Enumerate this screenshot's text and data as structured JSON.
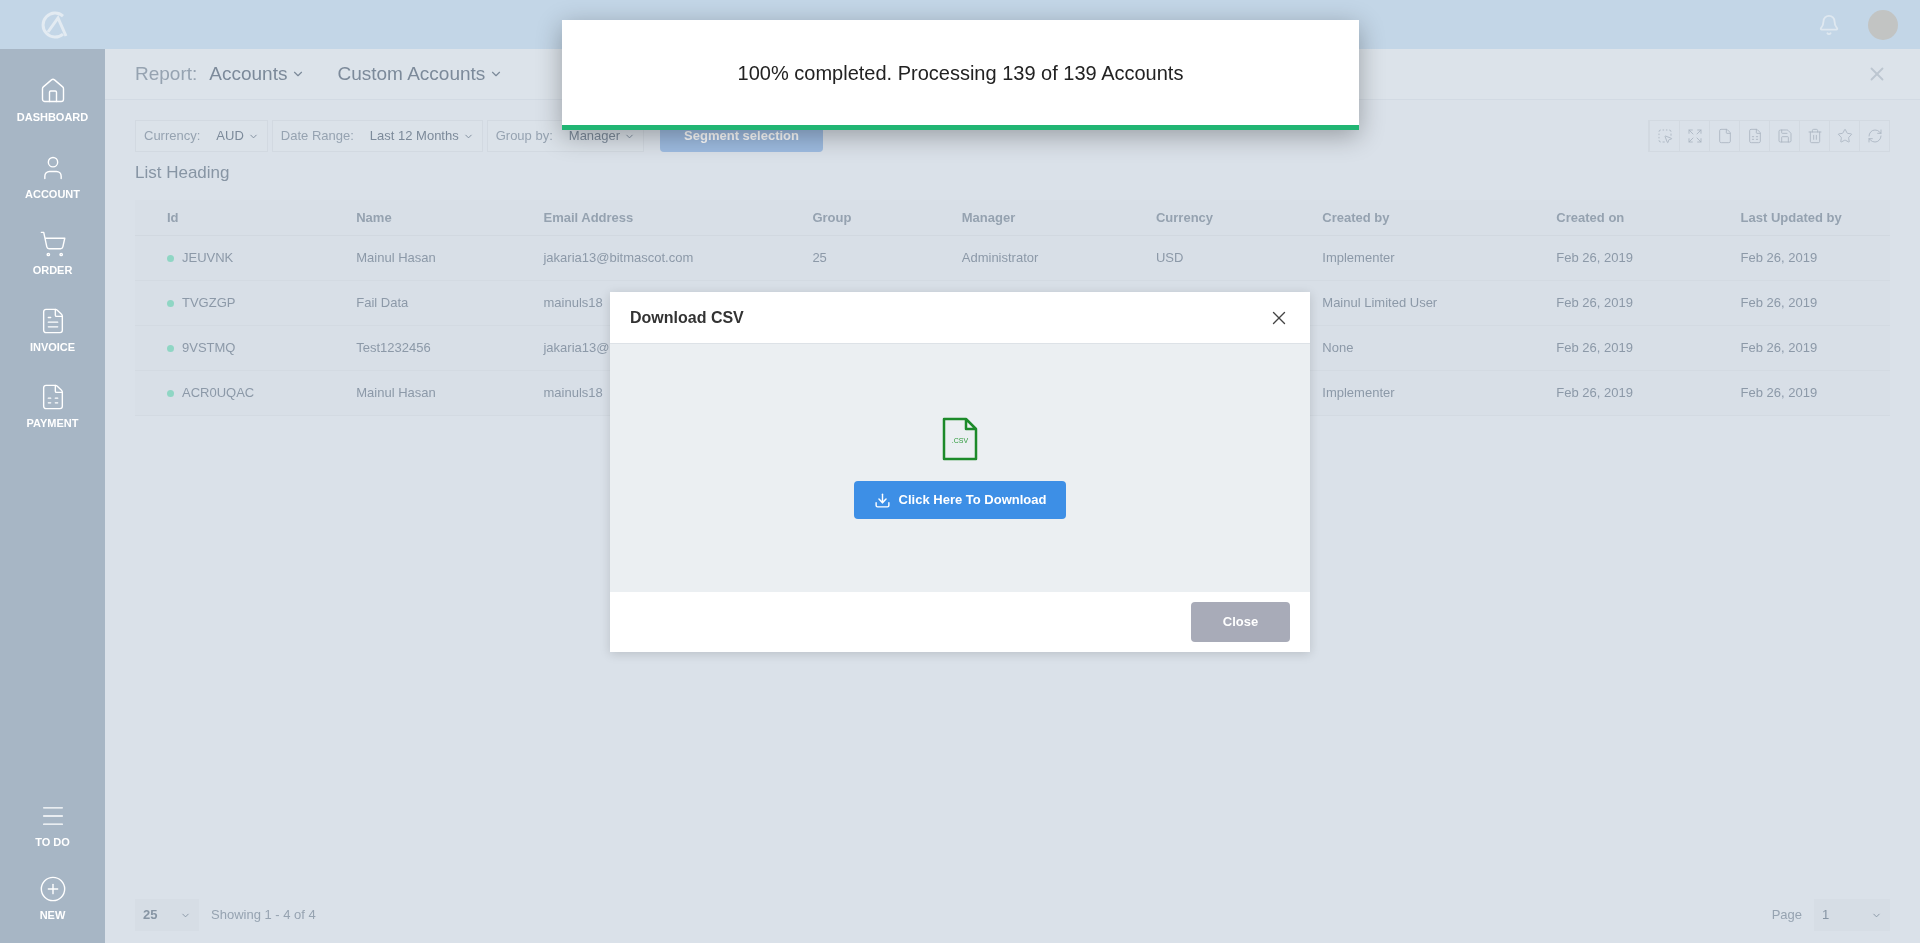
{
  "sidebar": {
    "items": [
      {
        "label": "DASHBOARD",
        "kind": "home"
      },
      {
        "label": "ACCOUNT",
        "kind": "user"
      },
      {
        "label": "ORDER",
        "kind": "cart"
      },
      {
        "label": "INVOICE",
        "kind": "invoice"
      },
      {
        "label": "PAYMENT",
        "kind": "payment"
      }
    ],
    "bottom_items": [
      {
        "label": "TO DO",
        "kind": "todo"
      },
      {
        "label": "NEW",
        "kind": "new"
      }
    ]
  },
  "report_bar": {
    "label": "Report:",
    "report": "Accounts",
    "view": "Custom Accounts"
  },
  "filters": [
    {
      "label": "Currency:",
      "value": "AUD"
    },
    {
      "label": "Date Range:",
      "value": "Last 12 Months"
    },
    {
      "label": "Group by:",
      "value": "Manager"
    }
  ],
  "segment_button": "Segment selection",
  "list_heading": "List Heading",
  "table": {
    "columns": [
      "Id",
      "Name",
      "Email Address",
      "Group",
      "Manager",
      "Currency",
      "Created by",
      "Created on",
      "Last Updated by"
    ],
    "rows": [
      {
        "color": "#8fd6c4",
        "cells": [
          "JEUVNK",
          "Mainul Hasan",
          "jakaria13@bitmascot.com",
          "25",
          "Administrator",
          "USD",
          "Implementer",
          "Feb 26, 2019",
          "Feb 26, 2019"
        ]
      },
      {
        "color": "#8fd6c4",
        "cells": [
          "TVGZGP",
          "Fail Data",
          "mainuls18",
          null,
          null,
          null,
          "Mainul Limited User",
          "Feb 26, 2019",
          "Feb 26, 2019"
        ]
      },
      {
        "color": "#8fd6c4",
        "cells": [
          "9VSTMQ",
          "Test1232456",
          "jakaria13@",
          null,
          null,
          null,
          "None",
          "Feb 26, 2019",
          "Feb 26, 2019"
        ]
      },
      {
        "color": "#8fd6c4",
        "cells": [
          "ACR0UQAC",
          "Mainul Hasan",
          "mainuls18",
          null,
          null,
          null,
          "Implementer",
          "Feb 26, 2019",
          "Feb 26, 2019"
        ]
      }
    ]
  },
  "footer": {
    "page_size": "25",
    "showing": "Showing 1 - 4 of 4",
    "page_label": "Page",
    "page": "1"
  },
  "progress_toast": {
    "message": "100% completed. Processing 139 of 139 Accounts",
    "level": 1
  },
  "dialog": {
    "title": "Download CSV",
    "file_label": ".CSV",
    "download_button": "Click Here To Download",
    "close_button": "Close"
  }
}
